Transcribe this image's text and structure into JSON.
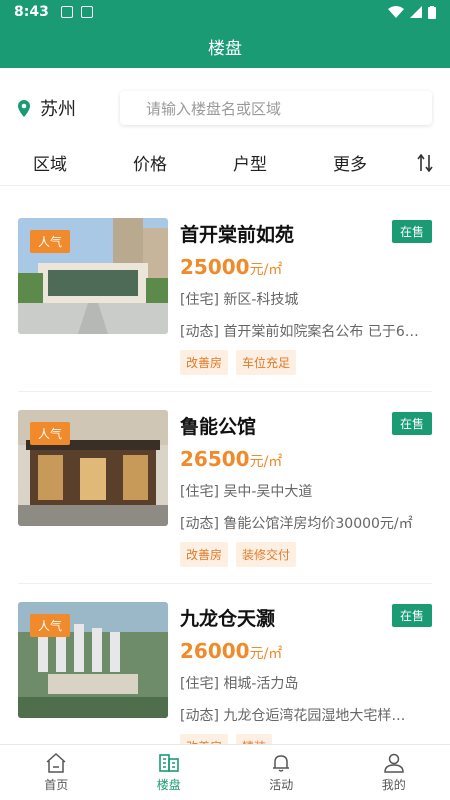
{
  "status_bar": {
    "time": "8:43"
  },
  "header": {
    "title": "楼盘"
  },
  "location": {
    "city": "苏州"
  },
  "search": {
    "placeholder": "请输入楼盘名或区域"
  },
  "filters": [
    "区域",
    "价格",
    "户型",
    "更多"
  ],
  "listings": [
    {
      "badge": "人气",
      "name": "首开棠前如苑",
      "status": "在售",
      "price": "25000",
      "price_unit": "元/㎡",
      "type_line": "[住宅] 新区-科技城",
      "news_line": "[动态] 首开棠前如院案名公布 已于6…",
      "tags": [
        "改善房",
        "车位充足"
      ]
    },
    {
      "badge": "人气",
      "name": "鲁能公馆",
      "status": "在售",
      "price": "26500",
      "price_unit": "元/㎡",
      "type_line": "[住宅] 吴中-吴中大道",
      "news_line": "[动态] 鲁能公馆洋房均价30000元/㎡",
      "tags": [
        "改善房",
        "装修交付"
      ]
    },
    {
      "badge": "人气",
      "name": "九龙仓天灏",
      "status": "在售",
      "price": "26000",
      "price_unit": "元/㎡",
      "type_line": "[住宅] 相城-活力岛",
      "news_line": "[动态] 九龙仓逅湾花园湿地大宅样…",
      "tags": [
        "改善房",
        "精装"
      ]
    }
  ],
  "bottom_nav": [
    {
      "label": "首页",
      "icon": "home-icon",
      "active": false
    },
    {
      "label": "楼盘",
      "icon": "building-list-icon",
      "active": true
    },
    {
      "label": "活动",
      "icon": "bell-icon",
      "active": false
    },
    {
      "label": "我的",
      "icon": "user-icon",
      "active": false
    }
  ],
  "colors": {
    "primary": "#1b9b74",
    "accent": "#f08a2a",
    "tag_bg": "#fdf0e3"
  }
}
